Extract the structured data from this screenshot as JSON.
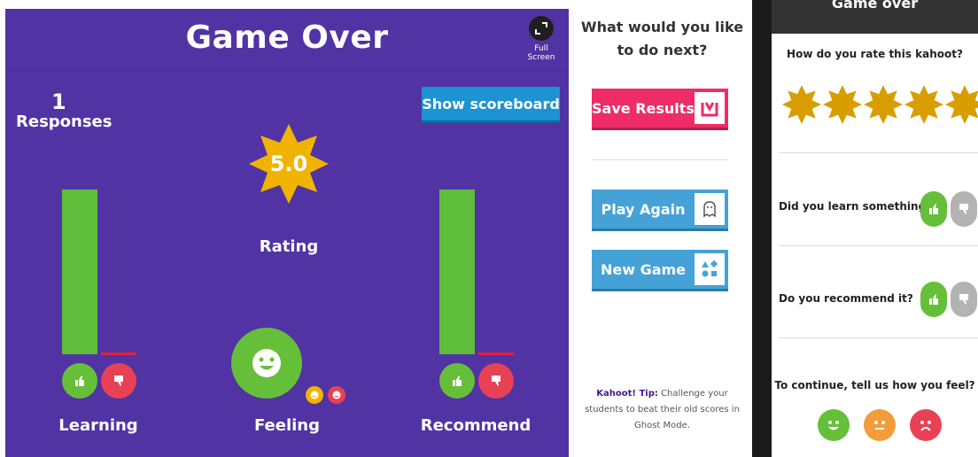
{
  "left": {
    "title": "Game Over",
    "fullscreen_label": "Full Screen",
    "responses_count": "1",
    "responses_label": "Responses",
    "scoreboard_button": "Show scoreboard",
    "rating_value": "5.0",
    "rating_label": "Rating",
    "learning_label": "Learning",
    "feeling_label": "Feeling",
    "recommend_label": "Recommend"
  },
  "middle": {
    "question_line1": "What would you like",
    "question_line2": "to do next?",
    "save_button": "Save Results",
    "play_button": "Play Again",
    "new_game_button": "New Game",
    "tip_label": "Kahoot! Tip:",
    "tip_text": " Challenge your students to beat their old scores in Ghost Mode."
  },
  "right": {
    "header_title": "Game over",
    "rate_question": "How do you rate this kahoot?",
    "learn_question": "Did you learn something?",
    "recommend_question": "Do you recommend it?",
    "feel_question": "To continue, tell us how you feel?"
  },
  "colors": {
    "purple": "#5133a4",
    "green": "#66bf39",
    "red": "#e84155",
    "blue": "#45a2d6",
    "pink": "#ee2c67",
    "gold": "#d89e00"
  }
}
